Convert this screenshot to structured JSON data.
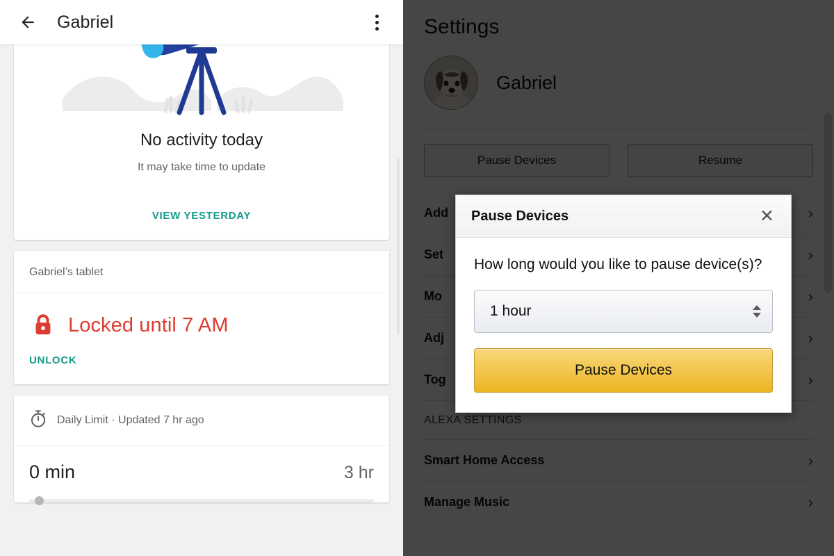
{
  "left_panel": {
    "appbar": {
      "back_label": "Back",
      "title": "Gabriel",
      "overflow_label": "More options"
    },
    "activity_card": {
      "headline": "No activity today",
      "subtext": "It may take time to update",
      "action_label": "VIEW YESTERDAY",
      "illustration": "telescope-illustration"
    },
    "device_card": {
      "device_name": "Gabriel’s tablet",
      "status_text": "Locked until 7 AM",
      "status_icon": "lock-icon",
      "action_label": "UNLOCK"
    },
    "limit_card": {
      "header_icon": "stopwatch-icon",
      "header_text": "Daily Limit · Updated 7 hr ago",
      "used": "0 min",
      "total": "3 hr",
      "progress_percent": 0
    },
    "colors": {
      "link_teal": "#12998a",
      "lock_red": "#dc3d32",
      "telescope_blue": "#1f3a93",
      "telescope_lens": "#35b4ec"
    }
  },
  "right_panel": {
    "title": "Settings",
    "profile": {
      "name": "Gabriel",
      "avatar": "dog-avatar"
    },
    "buttons": [
      {
        "label": "Pause Devices",
        "name": "pause-devices-button"
      },
      {
        "label": "Resume",
        "name": "resume-button"
      }
    ],
    "menu_items": [
      {
        "label": "Add",
        "truncated": true
      },
      {
        "label": "Set",
        "truncated": true
      },
      {
        "label": "Mo",
        "truncated": true
      },
      {
        "label": "Adj",
        "truncated": true
      },
      {
        "label": "Tog",
        "truncated": true
      }
    ],
    "section_header": "ALEXA SETTINGS",
    "alexa_items": [
      {
        "label": "Smart Home Access"
      },
      {
        "label": "Manage Music"
      }
    ],
    "chevron_glyph": "›"
  },
  "modal": {
    "title": "Pause Devices",
    "close_label": "✕",
    "question": "How long would you like to pause device(s)?",
    "select_value": "1 hour",
    "select_options": [
      "1 hour"
    ],
    "cta_label": "Pause Devices",
    "accent_color": "#edb521"
  }
}
